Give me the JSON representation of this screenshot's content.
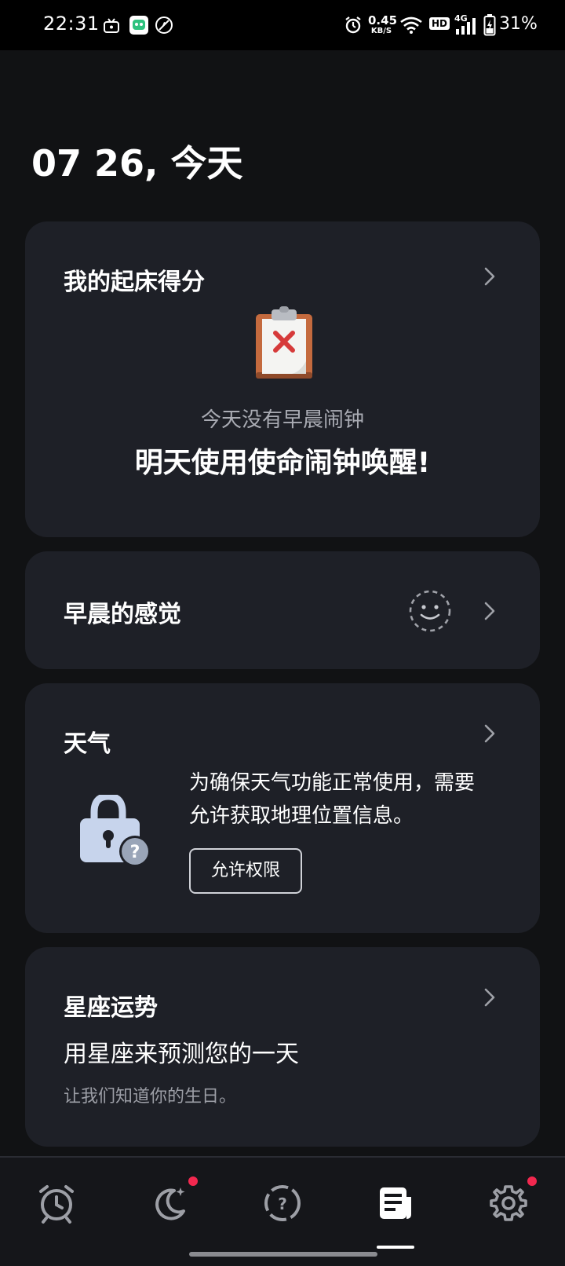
{
  "status_bar": {
    "time": "22:31",
    "net_speed_value": "0.45",
    "net_speed_unit": "KB/S",
    "hd": "HD",
    "network": "4G",
    "battery": "31%"
  },
  "header": {
    "date_title": "07 26, 今天"
  },
  "wake_score_card": {
    "title": "我的起床得分",
    "no_alarm_text": "今天没有早晨闹钟",
    "cta_text": "明天使用使命闹钟唤醒!"
  },
  "morning_feeling_card": {
    "title": "早晨的感觉"
  },
  "weather_card": {
    "title": "天气",
    "message_line1": "为确保天气功能正常使用，需要",
    "message_line2": "允许获取地理位置信息。",
    "permission_button": "允许权限"
  },
  "horoscope_card": {
    "title": "星座运势",
    "subtitle": "用星座来预测您的一天",
    "hint": "让我们知道你的生日。"
  },
  "bottom_nav": {
    "active_index": 3,
    "items": [
      {
        "icon": "alarm-clock-icon",
        "badge": false
      },
      {
        "icon": "moon-sleep-icon",
        "badge": true
      },
      {
        "icon": "question-mission-icon",
        "badge": false
      },
      {
        "icon": "report-news-icon",
        "badge": false
      },
      {
        "icon": "gear-settings-icon",
        "badge": true
      }
    ]
  },
  "colors": {
    "background": "#111214",
    "card": "#1e2027",
    "badge": "#f2284f",
    "lock": "#c7d4ec",
    "muted_text": "#a9abb3"
  }
}
